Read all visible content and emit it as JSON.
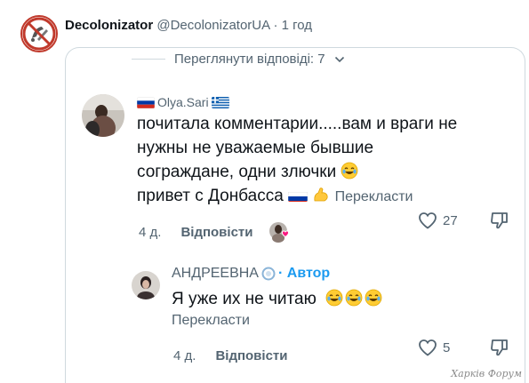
{
  "post": {
    "author_name": "Decolonizator",
    "meta": "@DecolonizatorUA · 1 год"
  },
  "thread": {
    "view_replies_label": "Переглянути відповіді: 7"
  },
  "reply1": {
    "username": "Olya.Sari",
    "text_line1": "почитала комментарии.....вам и враги не",
    "text_line2": "нужны не уважаемые бывшие",
    "text_line3": "сограждане, одни злючки",
    "text_line4": "привет с Донбасса",
    "translate_label": "Перекласти",
    "time": "4 д.",
    "reply_label": "Відповісти",
    "like_count": "27"
  },
  "reply2": {
    "username": "АНДРЕЕВНА",
    "author_badge": "· Автор",
    "text": "Я уже их не читаю",
    "translate_label": "Перекласти",
    "time": "4 д.",
    "reply_label": "Відповісти",
    "like_count": "5"
  },
  "watermark": "Харків Форум",
  "colors": {
    "text_primary": "#0f1419",
    "text_secondary": "#536471",
    "accent_blue": "#1d9bf0",
    "border": "#cfd9de"
  },
  "icons": [
    "no-symbol-logo-icon",
    "chevron-down-icon",
    "heart-icon",
    "dislike-icon",
    "russia-flag-icon",
    "greece-flag-icon",
    "flexed-biceps-icon",
    "laughing-face-icon",
    "verified-circle-icon"
  ]
}
